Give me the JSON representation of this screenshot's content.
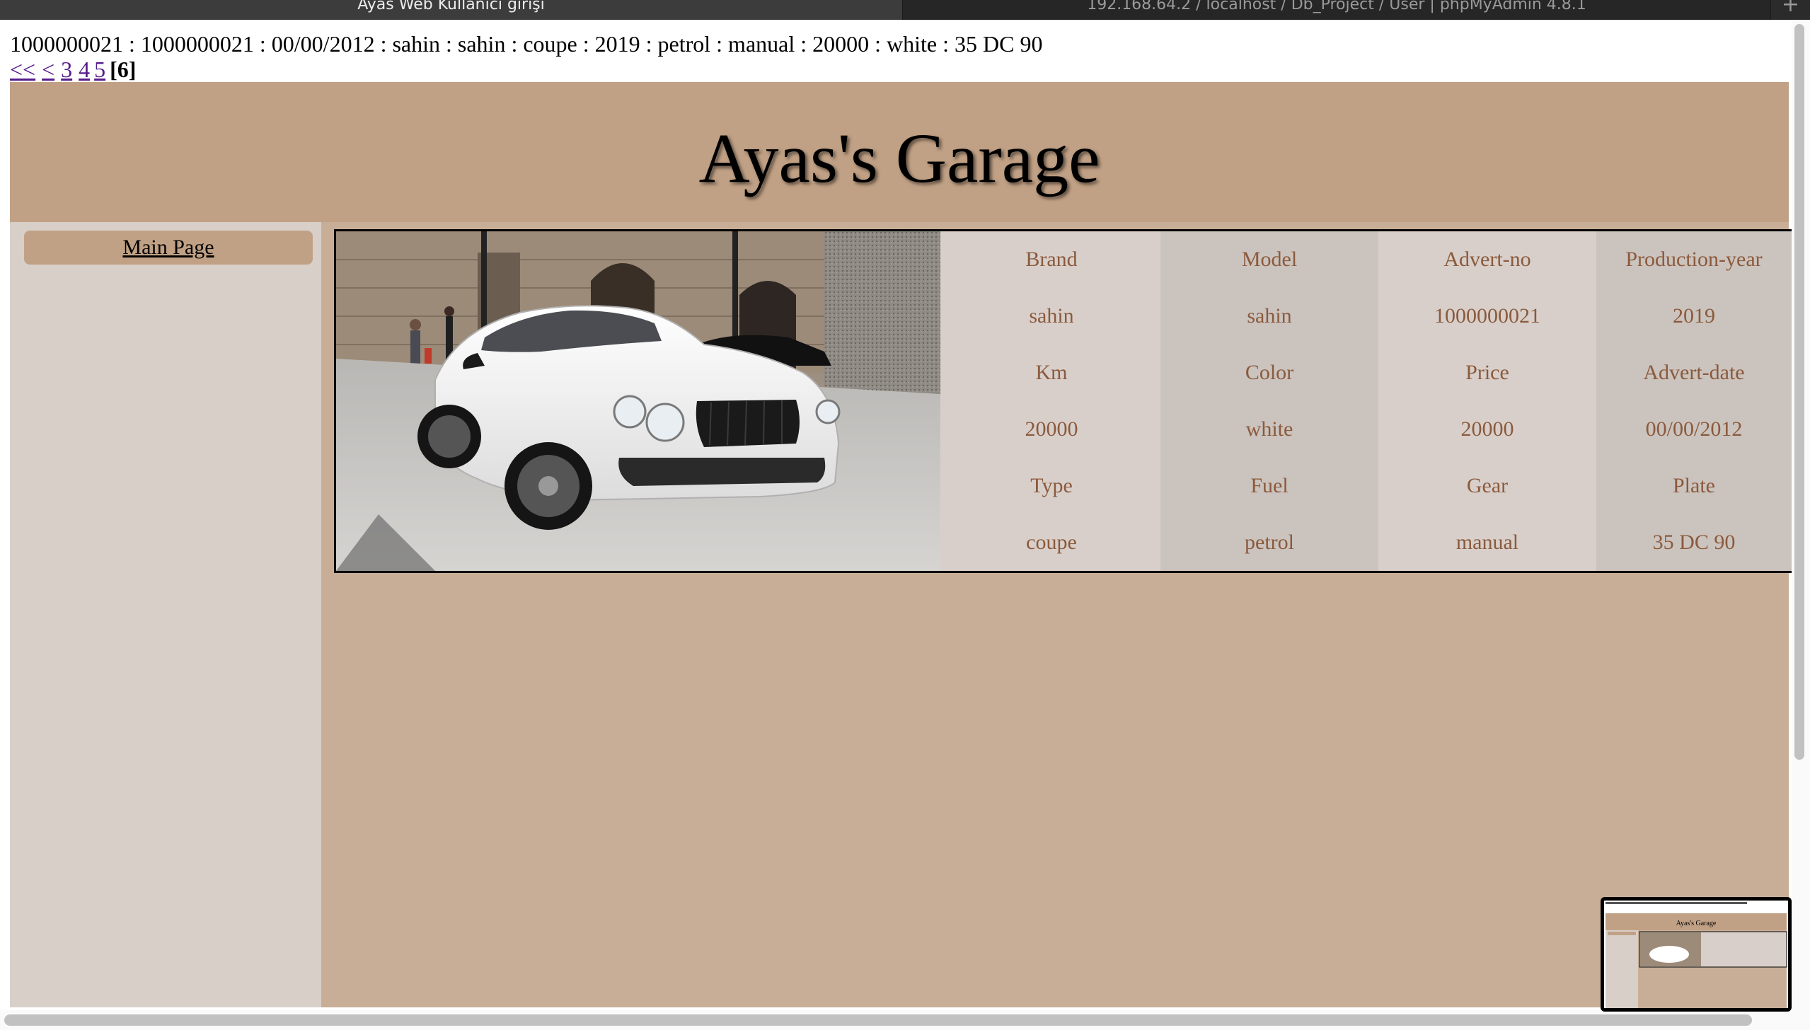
{
  "browser": {
    "tabs": [
      {
        "title": "Ayas Web Kullanıcı girişi",
        "active": true
      },
      {
        "title": "192.168.64.2 / localhost / Db_Project / User | phpMyAdmin 4.8.1",
        "active": false
      }
    ],
    "new_tab_icon": "plus-icon"
  },
  "record_line": "1000000021 : 1000000021 : 00/00/2012 : sahin : sahin : coupe : 2019 : petrol : manual : 20000 : white : 35 DC 90",
  "pagination": {
    "first": "<<",
    "prev": "<",
    "pages": [
      "3",
      "4",
      "5"
    ],
    "current": "[6]"
  },
  "site_title": "Ayas's Garage",
  "sidebar": {
    "main_page_label": "Main Page"
  },
  "car": {
    "photo_icon": "white-coupe-car-photo",
    "details": {
      "row1_labels": [
        "Brand",
        "Model",
        "Advert-no",
        "Production-year"
      ],
      "row1_values": [
        "sahin",
        "sahin",
        "1000000021",
        "2019"
      ],
      "row2_labels": [
        "Km",
        "Color",
        "Price",
        "Advert-date"
      ],
      "row2_values": [
        "20000",
        "white",
        "20000",
        "00/00/2012"
      ],
      "row3_labels": [
        "Type",
        "Fuel",
        "Gear",
        "Plate"
      ],
      "row3_values": [
        "coupe",
        "petrol",
        "manual",
        "35 DC 90"
      ]
    }
  },
  "thumbnail_title": "Ayas's Garage",
  "colors": {
    "header_bg": "#c1a185",
    "sidebar_bg": "#d8cfc9",
    "content_bg": "#c9ae97",
    "detail_text": "#8b5a3c",
    "link": "#551a8b"
  }
}
